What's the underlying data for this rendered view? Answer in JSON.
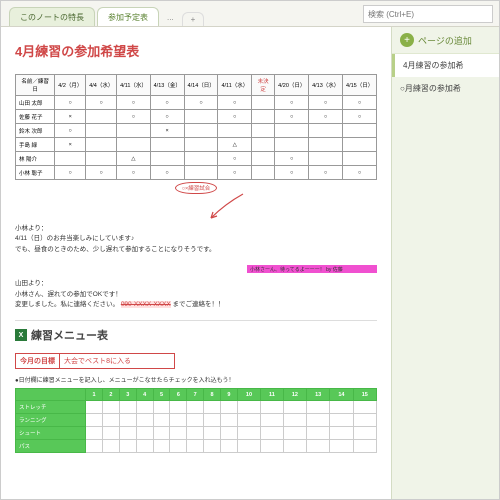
{
  "tabs": {
    "t1": "このノートの特長",
    "t2": "参加予定表",
    "more": "...",
    "plus": "+"
  },
  "search": {
    "placeholder": "検索 (Ctrl+E)"
  },
  "side": {
    "add": "ページの追加",
    "p1": "4月練習の参加希",
    "p2": "○月練習の参加希"
  },
  "title": "4月練習の参加希望表",
  "th": {
    "c0": "名前／練習日",
    "c1": "4/2（月）",
    "c2": "4/4（水）",
    "c3": "4/11（水）",
    "c4": "4/13（金）",
    "c5": "4/14（日）",
    "c6": "4/11（水）",
    "c7": "未決定",
    "c8": "4/20（日）",
    "c9": "4/13（水）",
    "c10": "4/15（日）"
  },
  "rows": [
    {
      "n": "山田 太郎",
      "v": [
        "○",
        "○",
        "○",
        "○",
        "○",
        "○",
        "",
        "○",
        "○",
        "○"
      ]
    },
    {
      "n": "佐藤 花子",
      "v": [
        "×",
        "",
        "○",
        "○",
        "",
        "○",
        "",
        "○",
        "○",
        "○"
      ]
    },
    {
      "n": "鈴木 次郎",
      "v": [
        "○",
        "",
        "",
        "×",
        "",
        "",
        "",
        "",
        "",
        ""
      ]
    },
    {
      "n": "手島 緑",
      "v": [
        "×",
        "",
        "",
        "",
        "",
        "△",
        "",
        "",
        "",
        ""
      ]
    },
    {
      "n": "林 陽介",
      "v": [
        "",
        "",
        "△",
        "",
        "",
        "○",
        "",
        "○",
        "",
        ""
      ]
    },
    {
      "n": "小林 聡子",
      "v": [
        "○",
        "○",
        "○",
        "○",
        "",
        "○",
        "",
        "○",
        "○",
        "○"
      ]
    }
  ],
  "circled": "○×練習試合",
  "note1": {
    "l1": "小林より：",
    "l2": "4/11（日）のお弁当楽しみにしています♪",
    "l3": "でも、昼食のときのため、少し遅れて参加することになりそうです。"
  },
  "pinkline": "小林さーん、待ってるよーーー！ by 佐藤",
  "note2": {
    "l1": "山田より：",
    "l2": "小林さん、遅れての参加でOKです！",
    "l3a": "変更しました。私に連絡ください。",
    "l3b": "090-XXXX-XXXX",
    "l3c": " までご連絡を！！"
  },
  "sec2": {
    "h": "練習メニュー表",
    "goal_lbl": "今月の目標",
    "goal_val": "大会でベスト8に入る",
    "hint": "●日付欄に練習メニューを記入し、メニューがこなせたらチェックを入れ込もう！"
  },
  "th2": [
    "",
    "1",
    "2",
    "3",
    "4",
    "5",
    "6",
    "7",
    "8",
    "9",
    "10",
    "11",
    "12",
    "13",
    "14",
    "15"
  ],
  "rows2": [
    {
      "n": "ストレッチ",
      "v": [
        "",
        "",
        "",
        "",
        "",
        "",
        "",
        "",
        "",
        "",
        "",
        "",
        "",
        "",
        ""
      ]
    },
    {
      "n": "ランニング",
      "v": [
        "",
        "",
        "",
        "",
        "",
        "",
        "",
        "",
        "",
        "",
        "",
        "",
        "",
        "",
        ""
      ]
    },
    {
      "n": "シュート",
      "v": [
        "",
        "",
        "",
        "",
        "",
        "",
        "",
        "",
        "",
        "",
        "",
        "",
        "",
        "",
        ""
      ]
    },
    {
      "n": "パス",
      "v": [
        "",
        "",
        "",
        "",
        "",
        "",
        "",
        "",
        "",
        "",
        "",
        "",
        "",
        "",
        ""
      ]
    }
  ]
}
